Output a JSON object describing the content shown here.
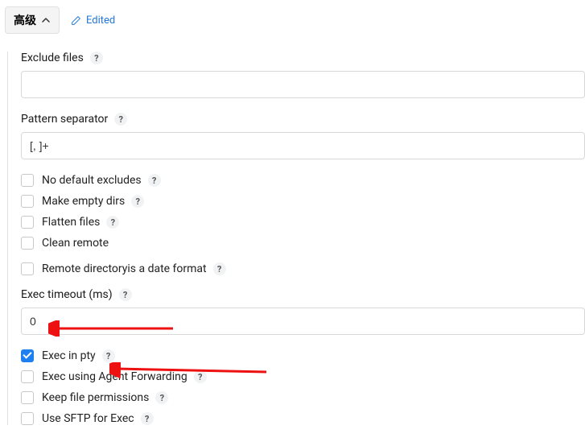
{
  "header": {
    "collapse_label": "高级",
    "edited_label": "Edited"
  },
  "fields": {
    "exclude_files": {
      "label": "Exclude files",
      "value": ""
    },
    "pattern_separator": {
      "label": "Pattern separator",
      "value": "[, ]+"
    },
    "exec_timeout": {
      "label": "Exec timeout (ms)",
      "value": "0"
    }
  },
  "checkboxes_group1": [
    {
      "key": "no-default-excludes",
      "label": "No default excludes",
      "has_help": true
    },
    {
      "key": "make-empty-dirs",
      "label": "Make empty dirs",
      "has_help": true
    },
    {
      "key": "flatten-files",
      "label": "Flatten files",
      "has_help": true
    },
    {
      "key": "clean-remote",
      "label": "Clean remote",
      "has_help": false
    }
  ],
  "checkboxes_group2": [
    {
      "key": "remote-directory-date",
      "label": "Remote directoryis a date format",
      "has_help": true
    }
  ],
  "checkboxes_group3": [
    {
      "key": "exec-in-pty",
      "label": "Exec in pty",
      "has_help": true,
      "checked": true
    },
    {
      "key": "exec-agent-forwarding",
      "label": "Exec using Agent Forwarding",
      "has_help": true
    },
    {
      "key": "keep-file-permissions",
      "label": "Keep file permissions",
      "has_help": true
    },
    {
      "key": "use-sftp-for-exec",
      "label": "Use SFTP for Exec",
      "has_help": true
    }
  ]
}
